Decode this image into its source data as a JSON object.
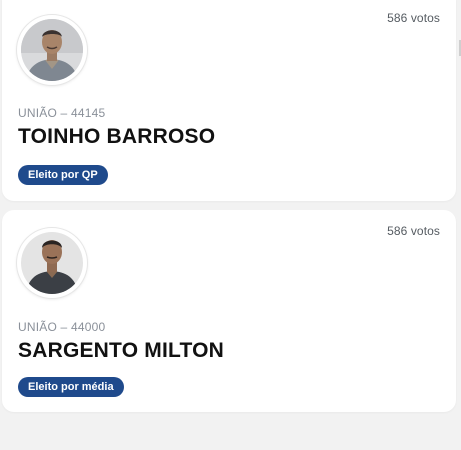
{
  "candidates": [
    {
      "votes": "586 votos",
      "party": "UNIÃO – 44145",
      "name": "TOINHO BARROSO",
      "status": "Eleito por QP",
      "avatar_icon": "candidate-photo"
    },
    {
      "votes": "586 votos",
      "party": "UNIÃO – 44000",
      "name": "SARGENTO MILTON",
      "status": "Eleito por média",
      "avatar_icon": "candidate-photo"
    }
  ],
  "colors": {
    "badge": "#1f4a8c",
    "card": "#ffffff",
    "background": "#f2f2f2"
  }
}
